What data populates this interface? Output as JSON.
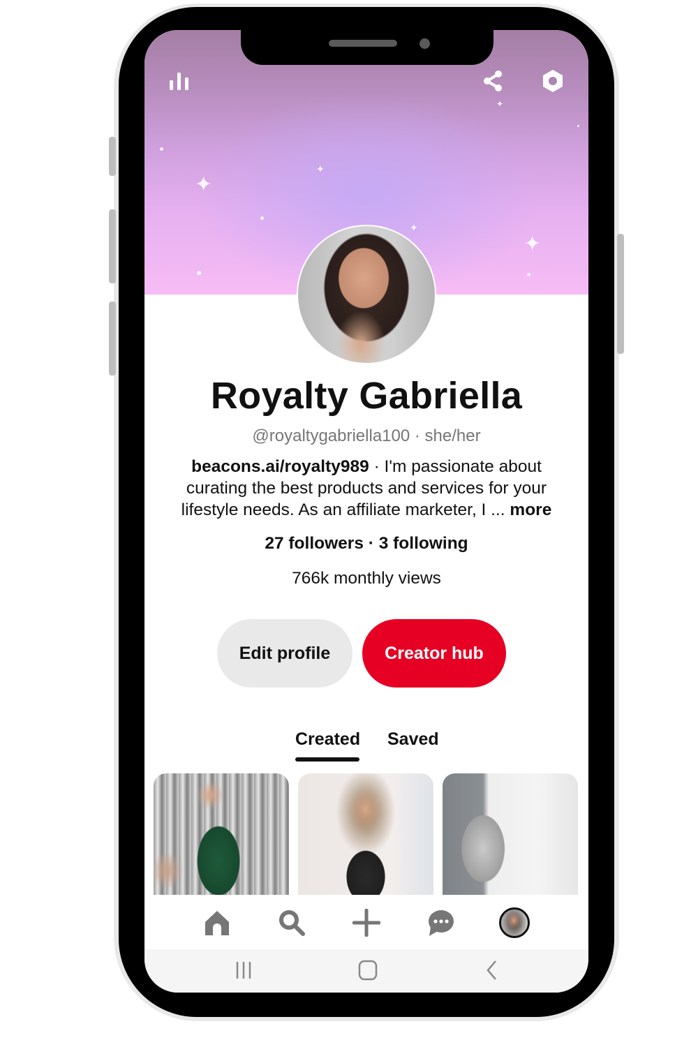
{
  "header": {
    "left_icon": "analytics-bar-chart-icon",
    "right_icons": [
      "share-icon",
      "settings-hexagon-icon"
    ]
  },
  "profile": {
    "name": "Royalty Gabriella",
    "handle_line": "@royaltygabriella100 · she/her",
    "bio_link": "beacons.ai/royalty989",
    "bio_text": " · I'm passionate about curating the best products and services for your lifestyle needs. As an affiliate marketer, I ... ",
    "bio_more": "more",
    "stats_line": "27 followers · 3 following",
    "monthly_views": "766k monthly views"
  },
  "actions": {
    "edit_profile": "Edit profile",
    "creator_hub": "Creator hub"
  },
  "tabs": [
    {
      "label": "Created",
      "active": true
    },
    {
      "label": "Saved",
      "active": false
    }
  ],
  "pins": [
    {
      "description": "Woman in green sequin dress, silver backdrop"
    },
    {
      "description": "Woman in black sparkly halter dress"
    },
    {
      "description": "Silver sequin mini dress"
    }
  ],
  "bottom_nav": [
    "home-icon",
    "search-icon",
    "create-plus-icon",
    "messages-icon",
    "profile-avatar"
  ],
  "system_nav": [
    "recent-apps-icon",
    "home-button-icon",
    "back-icon"
  ],
  "colors": {
    "accent": "#e60023",
    "secondary_button": "#e9e9e9",
    "text": "#111111",
    "muted_text": "#767676",
    "icon_gray": "#767676"
  }
}
